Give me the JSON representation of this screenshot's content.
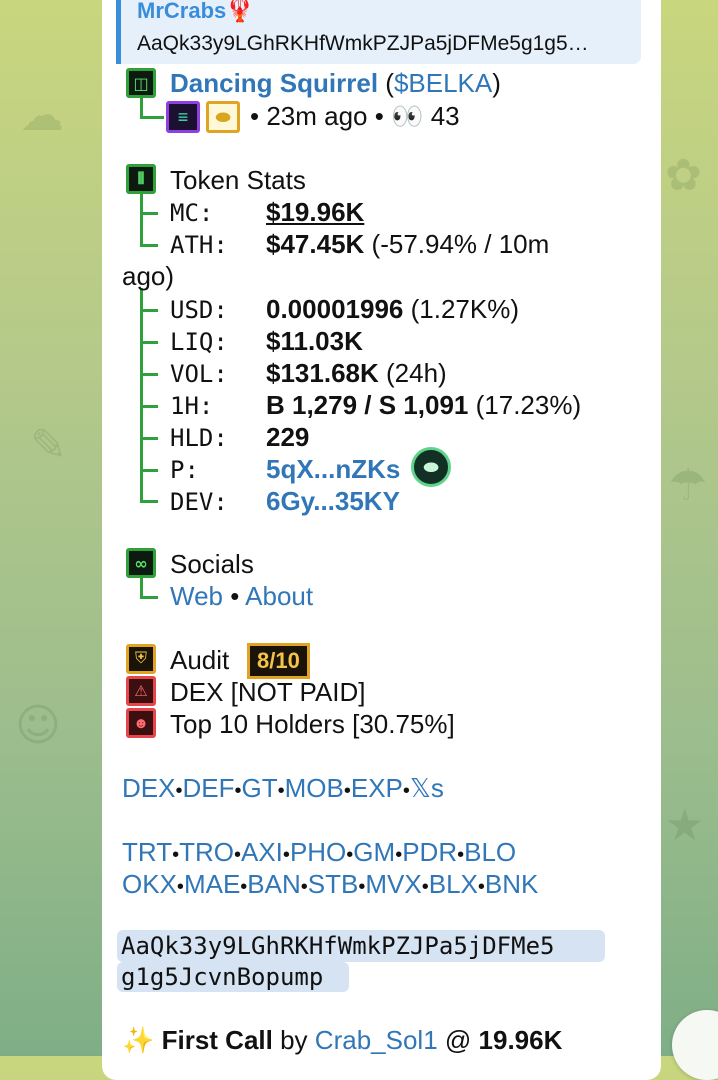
{
  "reply": {
    "name": "MrCrabs🦞",
    "text": "AaQk33y9LGhRKHfWmkPZJPa5jDFMe5g1g5…"
  },
  "token": {
    "name": "Dancing Squirrel",
    "ticker_open": "(",
    "ticker": "$BELKA",
    "ticker_close": ")",
    "age": "• 23m ago •",
    "views_icon": "👀",
    "views": "43"
  },
  "stats": {
    "title": "Token Stats",
    "rows": [
      {
        "label": "MC:",
        "value": "$19.96K"
      },
      {
        "label": "ATH:",
        "value": "$47.45K",
        "extra": "(-57.94% / 10m",
        "wrap": "ago)"
      },
      {
        "label": "USD:",
        "value": "0.00001996",
        "extra": "(1.27K%)"
      },
      {
        "label": "LIQ:",
        "value": "$11.03K"
      },
      {
        "label": "VOL:",
        "value": "$131.68K",
        "extra": "(24h)"
      },
      {
        "label": "1H:",
        "value": "B 1,279 / S 1,091",
        "extra": "(17.23%)"
      },
      {
        "label": "HLD:",
        "value": "229"
      },
      {
        "label": "P:",
        "value": "5qX...nZKs"
      },
      {
        "label": "DEV:",
        "value": "6Gy...35KY"
      }
    ]
  },
  "socials": {
    "title": "Socials",
    "links": [
      "Web",
      "About"
    ],
    "sep": "•"
  },
  "audit": {
    "title": "Audit",
    "score": "8/10",
    "items": [
      "DEX [NOT PAID]",
      "Top 10 Holders [30.75%]"
    ]
  },
  "link_rows": [
    [
      "DEX",
      "DEF",
      "GT",
      "MOB",
      "EXP",
      "𝕏s"
    ],
    [
      "TRT",
      "TRO",
      "AXI",
      "PHO",
      "GM",
      "PDR",
      "BLO"
    ],
    [
      "OKX",
      "MAE",
      "BAN",
      "STB",
      "MVX",
      "BLX",
      "BNK"
    ]
  ],
  "link_sep": "•",
  "contract": {
    "line1": "AaQk33y9LGhRKHfWmkPZJPa5jDFMe5",
    "line2": "g1g5JcvnBopump"
  },
  "first_call": {
    "icon": "✨",
    "label": "First Call",
    "by": "by",
    "user": "Crab_Sol1",
    "at": "@",
    "value": "19.96K"
  },
  "colors": {
    "accent_green": "#2fa13b",
    "link_blue": "#3177b7",
    "audit_gold": "#e0a323",
    "alert_red": "#e6454a"
  }
}
